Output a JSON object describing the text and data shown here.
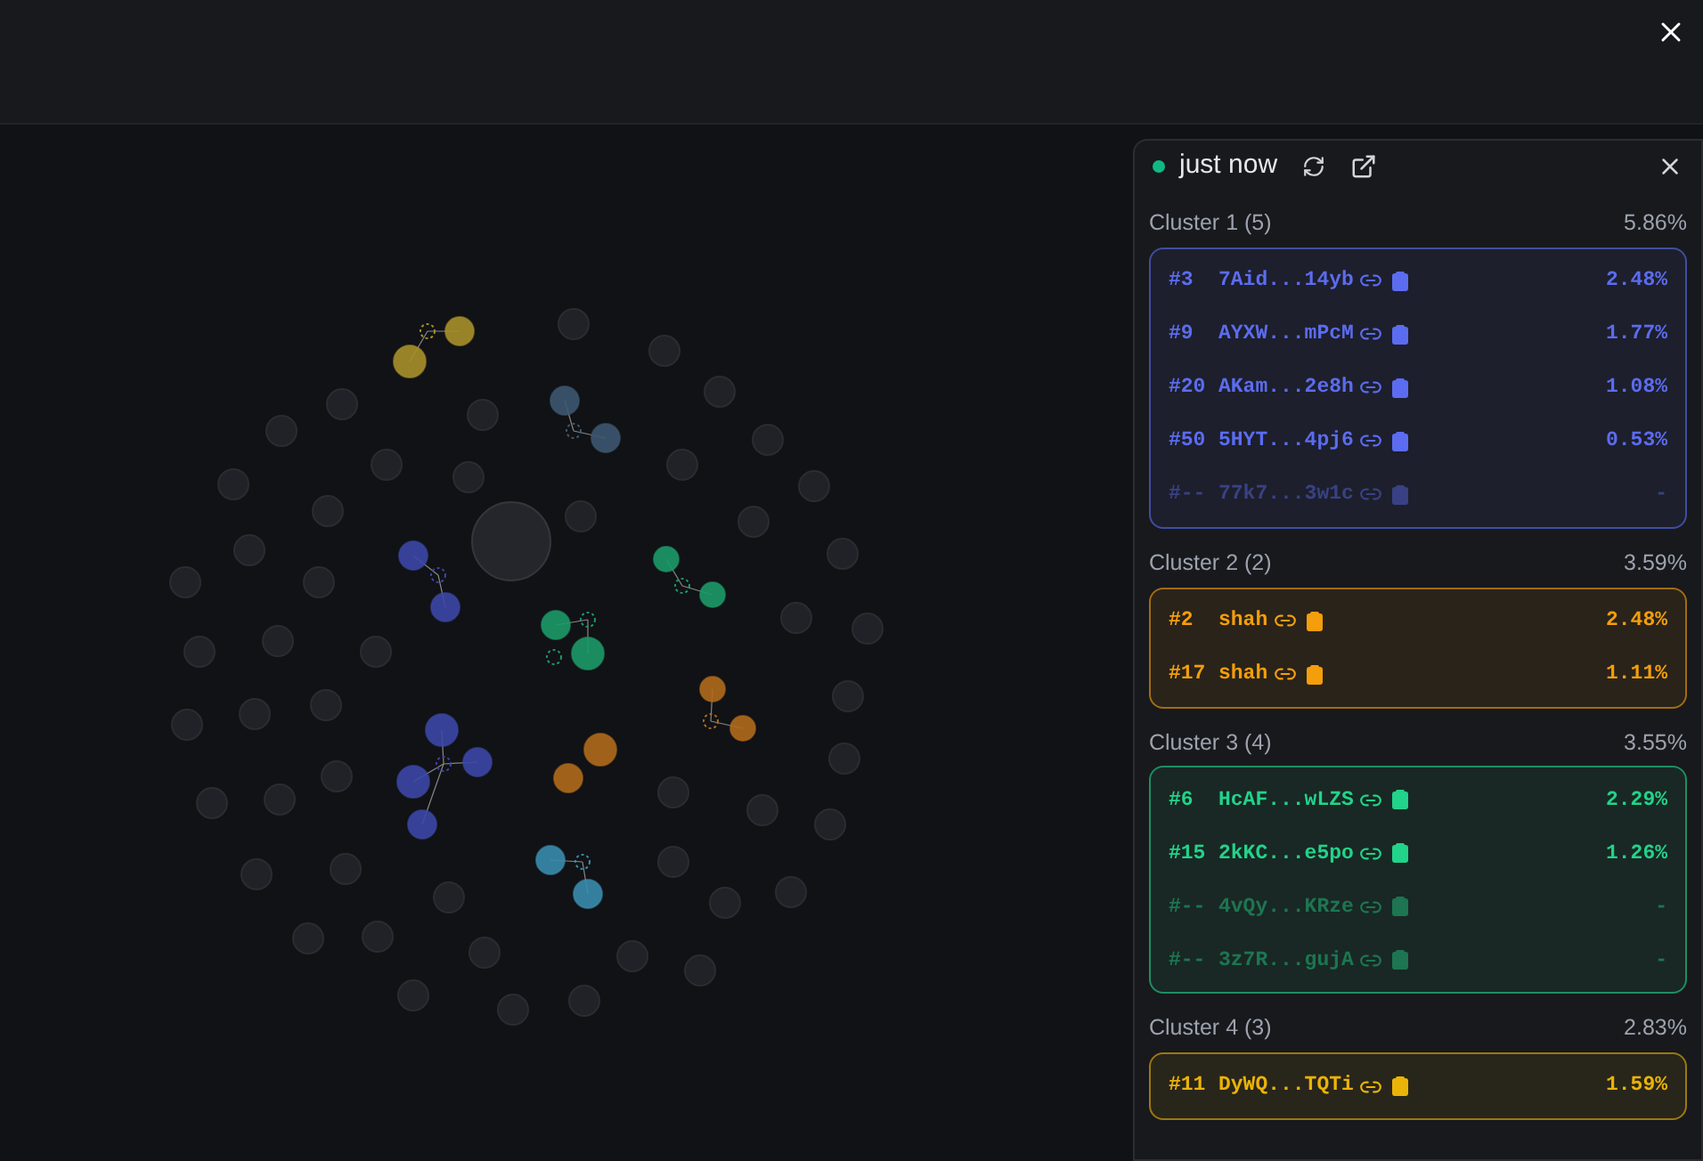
{
  "panel": {
    "status": {
      "label": "just now",
      "color": "#10b981"
    },
    "clusters": [
      {
        "label": "Cluster 1 (5)",
        "share": "5.86%",
        "color": "#5b6cf0",
        "rows": [
          {
            "rank": "#3",
            "address": "7Aid...14yb",
            "share": "2.48%",
            "inactive": false
          },
          {
            "rank": "#9",
            "address": "AYXW...mPcM",
            "share": "1.77%",
            "inactive": false
          },
          {
            "rank": "#20",
            "address": "AKam...2e8h",
            "share": "1.08%",
            "inactive": false
          },
          {
            "rank": "#50",
            "address": "5HYT...4pj6",
            "share": "0.53%",
            "inactive": false
          },
          {
            "rank": "#--",
            "address": "77k7...3w1c",
            "share": "-",
            "inactive": true
          }
        ]
      },
      {
        "label": "Cluster 2 (2)",
        "share": "3.59%",
        "color": "#f59e0b",
        "rows": [
          {
            "rank": "#2",
            "address": "shah",
            "share": "2.48%",
            "inactive": false
          },
          {
            "rank": "#17",
            "address": "shah",
            "share": "1.11%",
            "inactive": false
          }
        ]
      },
      {
        "label": "Cluster 3 (4)",
        "share": "3.55%",
        "color": "#22d38a",
        "rows": [
          {
            "rank": "#6",
            "address": "HcAF...wLZS",
            "share": "2.29%",
            "inactive": false
          },
          {
            "rank": "#15",
            "address": "2kKC...e5po",
            "share": "1.26%",
            "inactive": false
          },
          {
            "rank": "#--",
            "address": "4vQy...KRze",
            "share": "-",
            "inactive": true
          },
          {
            "rank": "#--",
            "address": "3z7R...gujA",
            "share": "-",
            "inactive": true
          }
        ]
      },
      {
        "label": "Cluster 4 (3)",
        "share": "2.83%",
        "color": "#eab308",
        "rows": [
          {
            "rank": "#11",
            "address": "DyWQ...TQTi",
            "share": "1.59%",
            "inactive": false
          }
        ]
      }
    ]
  }
}
